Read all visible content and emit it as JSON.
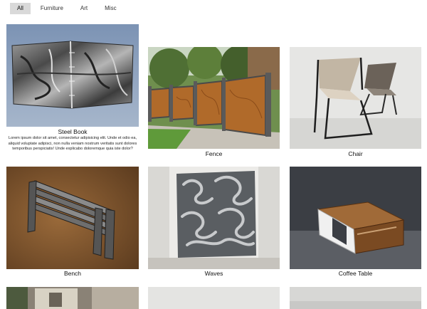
{
  "filters": [
    {
      "label": "All",
      "active": true
    },
    {
      "label": "Furniture",
      "active": false
    },
    {
      "label": "Art",
      "active": false
    },
    {
      "label": "Misc",
      "active": false
    }
  ],
  "gallery": {
    "items": [
      {
        "title": "Steel Book",
        "description": "Lorem ipsum dolor sit amet, consectetur adipisicing elit. Unde et odio ea, aliquid voluptate adipisci, non nulla veniam nostrum veritatis sunt dolores temporibus perspiciatis! Unde explicabo doloremque quia iste dolor?",
        "image_icon": "crumpled-steel-book-image"
      },
      {
        "title": "Fence",
        "image_icon": "decorative-fence-image"
      },
      {
        "title": "Chair",
        "image_icon": "metal-chairs-image"
      },
      {
        "title": "Bench",
        "image_icon": "slatted-metal-bench-image"
      },
      {
        "title": "Waves",
        "image_icon": "wave-screen-image"
      },
      {
        "title": "Coffee Table",
        "image_icon": "wood-coffee-table-image"
      },
      {
        "title": "",
        "image_icon": "brick-wall-image"
      },
      {
        "title": "",
        "image_icon": "light-wall-image"
      },
      {
        "title": "",
        "image_icon": "grey-wall-image"
      }
    ]
  }
}
